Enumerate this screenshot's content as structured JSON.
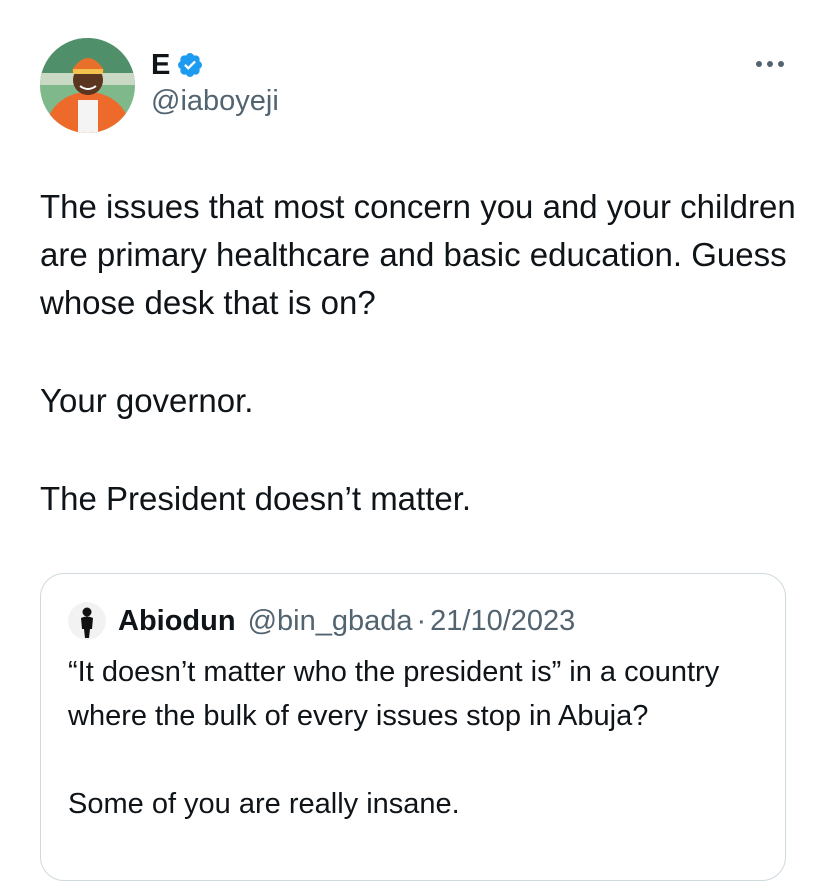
{
  "author": {
    "name": "E",
    "handle": "@iaboyeji",
    "verified": true,
    "avatar_icon": "profile-photo-man-orange-attire"
  },
  "tweet": {
    "paragraphs": [
      "The issues that most concern you and your children are primary healthcare and basic education. Guess whose desk that is on?",
      "Your governor.",
      "The President doesn’t matter."
    ]
  },
  "quoted_tweet": {
    "name": "Abiodun",
    "handle": "@bin_gbada",
    "separator": "·",
    "date": "21/10/2023",
    "avatar_icon": "silhouette-icon",
    "paragraphs": [
      "“It doesn’t matter who the president is” in a country where the bulk of every issues stop in Abuja?",
      "Some of you are really insane."
    ]
  },
  "colors": {
    "text": "#0f1419",
    "secondary": "#536471",
    "verified": "#1d9bf0",
    "border": "#cfd9de"
  },
  "icons": {
    "more": "more-horizontal-icon",
    "verified": "verified-badge-icon"
  }
}
